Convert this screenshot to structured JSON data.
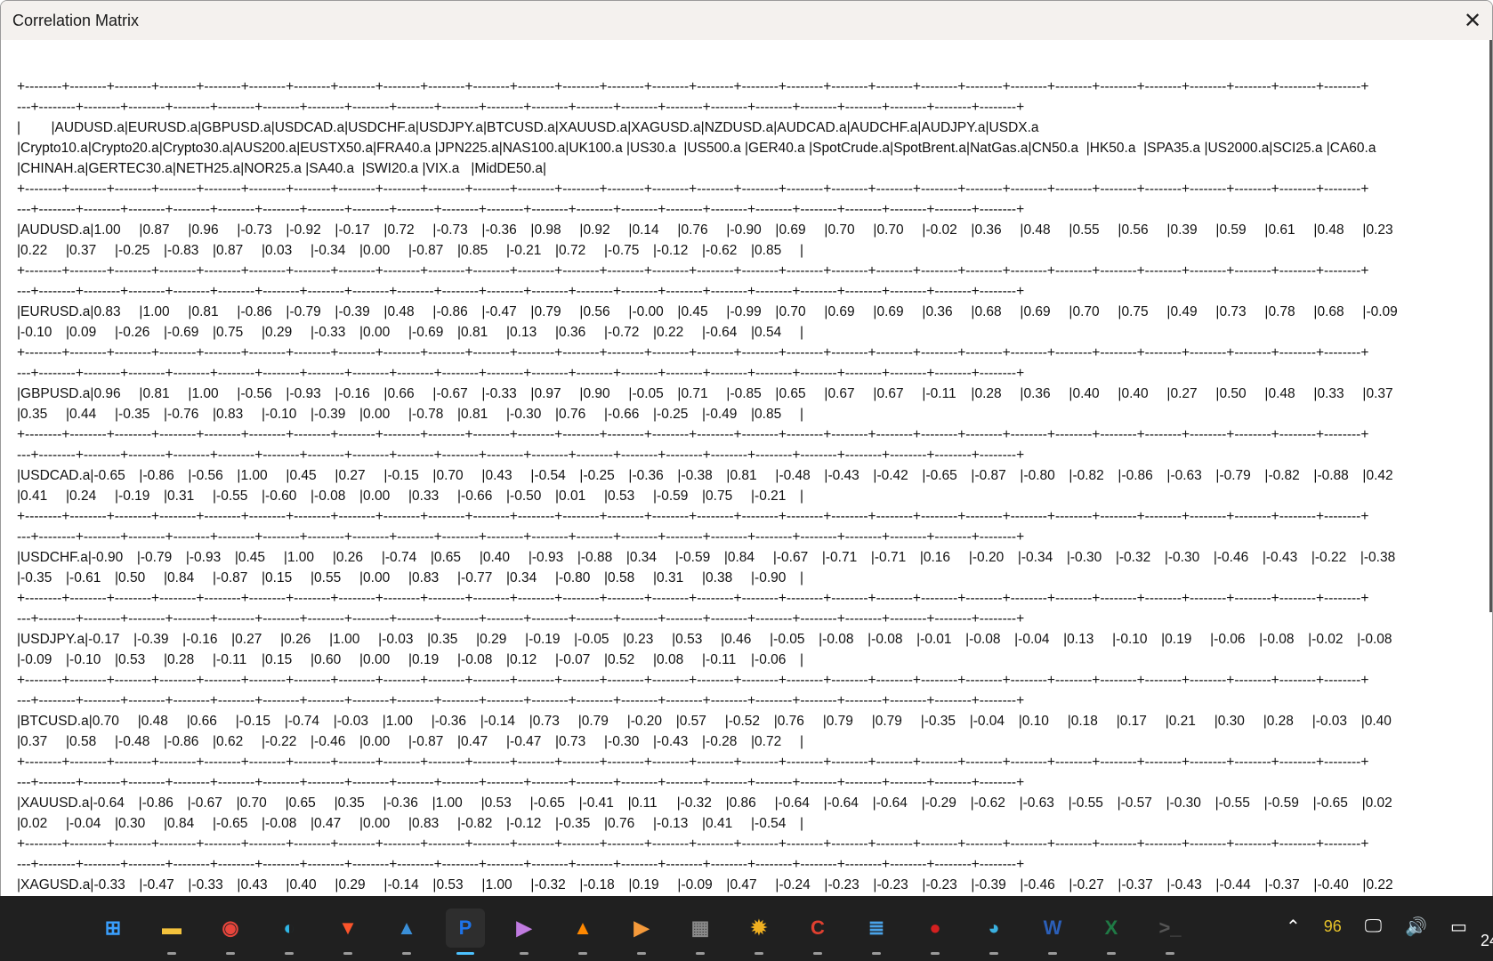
{
  "window": {
    "title": "Correlation Matrix",
    "close_icon": "close-icon"
  },
  "separator": [
    "+--------+--------+--------+--------+--------+--------+--------+--------+--------+--------+--------+--------+--------+--------+--------+--------+--------+--------+--------+--------+--------+--------+--------+--------+--------+--------+--------+--------+--------+--------+",
    "---+--------+--------+--------+--------+--------+--------+--------+--------+--------+--------+--------+--------+--------+--------+--------+--------+--------+--------+--------+--------+--------+--------+"
  ],
  "header_lines": [
    "|        |AUDUSD.a|EURUSD.a|GBPUSD.a|USDCAD.a|USDCHF.a|USDJPY.a|BTCUSD.a|XAUUSD.a|XAGUSD.a|NZDUSD.a|AUDCAD.a|AUDCHF.a|AUDJPY.a|USDX.a",
    "|Crypto10.a|Crypto20.a|Crypto30.a|AUS200.a|EUSTX50.a|FRA40.a |JPN225.a|NAS100.a|UK100.a |US30.a  |US500.a |GER40.a |SpotCrude.a|SpotBrent.a|NatGas.a|CN50.a  |HK50.a  |SPA35.a |US2000.a|SCI25.a |CA60.a",
    "|CHINAH.a|GERTEC30.a|NETH25.a|NOR25.a |SA40.a  |SWI20.a |VIX.a   |MidDE50.a|"
  ],
  "rows": [
    {
      "label": "AUDUSD.a",
      "values": [
        "1.00",
        "0.87",
        "0.96",
        "-0.73",
        "-0.92",
        "-0.17",
        "0.72",
        "-0.73",
        "-0.36",
        "0.98",
        "0.92",
        "0.14",
        "0.76",
        "-0.90",
        "0.69",
        "0.70",
        "0.70",
        "-0.02",
        "0.36",
        "0.48",
        "0.55",
        "0.56",
        "0.39",
        "0.59",
        "0.61",
        "0.48",
        "0.23",
        "0.22",
        "0.37",
        "-0.25",
        "-0.83",
        "0.87",
        "0.03",
        "-0.34",
        "0.00",
        "-0.87",
        "0.85",
        "-0.21",
        "0.72",
        "-0.75",
        "-0.12",
        "-0.62",
        "0.85"
      ]
    },
    {
      "label": "EURUSD.a",
      "values": [
        "0.83",
        "1.00",
        "0.81",
        "-0.86",
        "-0.79",
        "-0.39",
        "0.48",
        "-0.86",
        "-0.47",
        "0.79",
        "0.56",
        "-0.00",
        "0.45",
        "-0.99",
        "0.70",
        "0.69",
        "0.69",
        "0.36",
        "0.68",
        "0.69",
        "0.70",
        "0.75",
        "0.49",
        "0.73",
        "0.78",
        "0.68",
        "-0.09",
        "-0.10",
        "0.09",
        "-0.26",
        "-0.69",
        "0.75",
        "0.29",
        "-0.33",
        "0.00",
        "-0.69",
        "0.81",
        "0.13",
        "0.36",
        "-0.72",
        "0.22",
        "-0.64",
        "0.54"
      ]
    },
    {
      "label": "GBPUSD.a",
      "values": [
        "0.96",
        "0.81",
        "1.00",
        "-0.56",
        "-0.93",
        "-0.16",
        "0.66",
        "-0.67",
        "-0.33",
        "0.97",
        "0.90",
        "-0.05",
        "0.71",
        "-0.85",
        "0.65",
        "0.67",
        "0.67",
        "-0.11",
        "0.28",
        "0.36",
        "0.40",
        "0.40",
        "0.27",
        "0.50",
        "0.48",
        "0.33",
        "0.37",
        "0.35",
        "0.44",
        "-0.35",
        "-0.76",
        "0.83",
        "-0.10",
        "-0.39",
        "0.00",
        "-0.78",
        "0.81",
        "-0.30",
        "0.76",
        "-0.66",
        "-0.25",
        "-0.49",
        "0.85"
      ]
    },
    {
      "label": "USDCAD.a",
      "values": [
        "-0.65",
        "-0.86",
        "-0.56",
        "1.00",
        "0.45",
        "0.27",
        "-0.15",
        "0.70",
        "0.43",
        "-0.54",
        "-0.25",
        "-0.36",
        "-0.38",
        "0.81",
        "-0.48",
        "-0.43",
        "-0.42",
        "-0.65",
        "-0.87",
        "-0.80",
        "-0.82",
        "-0.86",
        "-0.63",
        "-0.79",
        "-0.82",
        "-0.88",
        "0.42",
        "0.41",
        "0.24",
        "-0.19",
        "0.31",
        "-0.55",
        "-0.60",
        "-0.08",
        "0.00",
        "0.33",
        "-0.66",
        "-0.50",
        "0.01",
        "0.53",
        "-0.59",
        "0.75",
        "-0.21"
      ]
    },
    {
      "label": "USDCHF.a",
      "values": [
        "-0.90",
        "-0.79",
        "-0.93",
        "0.45",
        "1.00",
        "0.26",
        "-0.74",
        "0.65",
        "0.40",
        "-0.93",
        "-0.88",
        "0.34",
        "-0.59",
        "0.84",
        "-0.67",
        "-0.71",
        "-0.71",
        "0.16",
        "-0.20",
        "-0.34",
        "-0.30",
        "-0.32",
        "-0.30",
        "-0.46",
        "-0.43",
        "-0.22",
        "-0.38",
        "-0.35",
        "-0.61",
        "0.50",
        "0.84",
        "-0.87",
        "0.15",
        "0.55",
        "0.00",
        "0.83",
        "-0.77",
        "0.34",
        "-0.80",
        "0.58",
        "0.31",
        "0.38",
        "-0.90"
      ]
    },
    {
      "label": "USDJPY.a",
      "values": [
        "-0.17",
        "-0.39",
        "-0.16",
        "0.27",
        "0.26",
        "1.00",
        "-0.03",
        "0.35",
        "0.29",
        "-0.19",
        "-0.05",
        "0.23",
        "0.53",
        "0.46",
        "-0.05",
        "-0.08",
        "-0.08",
        "-0.01",
        "-0.08",
        "-0.04",
        "0.13",
        "-0.10",
        "0.19",
        "-0.06",
        "-0.08",
        "-0.02",
        "-0.08",
        "-0.09",
        "-0.10",
        "0.53",
        "0.28",
        "-0.11",
        "0.15",
        "0.60",
        "0.00",
        "0.19",
        "-0.08",
        "0.12",
        "-0.07",
        "0.52",
        "0.08",
        "-0.11",
        "-0.06"
      ]
    },
    {
      "label": "BTCUSD.a",
      "values": [
        "0.70",
        "0.48",
        "0.66",
        "-0.15",
        "-0.74",
        "-0.03",
        "1.00",
        "-0.36",
        "-0.14",
        "0.73",
        "0.79",
        "-0.20",
        "0.57",
        "-0.52",
        "0.76",
        "0.79",
        "0.79",
        "-0.35",
        "-0.04",
        "0.10",
        "0.18",
        "0.17",
        "0.21",
        "0.30",
        "0.28",
        "-0.03",
        "0.40",
        "0.37",
        "0.58",
        "-0.48",
        "-0.86",
        "0.62",
        "-0.22",
        "-0.46",
        "0.00",
        "-0.87",
        "0.47",
        "-0.47",
        "0.73",
        "-0.30",
        "-0.43",
        "-0.28",
        "0.72"
      ]
    },
    {
      "label": "XAUUSD.a",
      "values": [
        "-0.64",
        "-0.86",
        "-0.67",
        "0.70",
        "0.65",
        "0.35",
        "-0.36",
        "1.00",
        "0.53",
        "-0.65",
        "-0.41",
        "0.11",
        "-0.32",
        "0.86",
        "-0.64",
        "-0.64",
        "-0.64",
        "-0.29",
        "-0.62",
        "-0.63",
        "-0.55",
        "-0.57",
        "-0.30",
        "-0.55",
        "-0.59",
        "-0.65",
        "0.02",
        "0.02",
        "-0.04",
        "0.30",
        "0.84",
        "-0.65",
        "-0.08",
        "0.47",
        "0.00",
        "0.83",
        "-0.82",
        "-0.12",
        "-0.35",
        "0.76",
        "-0.13",
        "0.41",
        "-0.54"
      ]
    },
    {
      "label": "XAGUSD.a",
      "values": [
        "-0.33",
        "-0.47",
        "-0.33",
        "0.43",
        "0.40",
        "0.29",
        "-0.14",
        "0.53",
        "1.00",
        "-0.32",
        "-0.18",
        "0.19",
        "-0.09",
        "0.47",
        "-0.24",
        "-0.23",
        "-0.23",
        "-0.23",
        "-0.39",
        "-0.46",
        "-0.27",
        "-0.37",
        "-0.43",
        "-0.44",
        "-0.37",
        "-0.40",
        "0.22"
      ]
    }
  ],
  "taskbar": {
    "apps": [
      {
        "name": "start-icon",
        "glyph": "⊞",
        "color": "#3aa0ff"
      },
      {
        "name": "file-explorer-icon",
        "glyph": "▬",
        "color": "#f3c23c"
      },
      {
        "name": "chrome-icon",
        "glyph": "◉",
        "color": "#e8453c"
      },
      {
        "name": "edge-icon",
        "glyph": "◐",
        "color": "#2fb6e6"
      },
      {
        "name": "brave-icon",
        "glyph": "▼",
        "color": "#fb542b"
      },
      {
        "name": "photos-icon",
        "glyph": "▲",
        "color": "#3a8fd8"
      },
      {
        "name": "p-app-icon",
        "glyph": "P",
        "color": "#1e73e8",
        "active": true
      },
      {
        "name": "media-player-icon",
        "glyph": "▶",
        "color": "#c07be0"
      },
      {
        "name": "vlc-icon",
        "glyph": "▲",
        "color": "#ff8800"
      },
      {
        "name": "video-player-icon",
        "glyph": "▶",
        "color": "#f59a3b"
      },
      {
        "name": "calculator-icon",
        "glyph": "▦",
        "color": "#8a8a8a"
      },
      {
        "name": "settings-gear-icon",
        "glyph": "✹",
        "color": "#f0b020"
      },
      {
        "name": "ccleaner-icon",
        "glyph": "C",
        "color": "#e04030"
      },
      {
        "name": "notepad-icon",
        "glyph": "≣",
        "color": "#4aa3e8"
      },
      {
        "name": "red-app-icon",
        "glyph": "●",
        "color": "#d42020"
      },
      {
        "name": "paint-icon",
        "glyph": "◕",
        "color": "#3ab0e0"
      },
      {
        "name": "word-icon",
        "glyph": "W",
        "color": "#2b5fb8"
      },
      {
        "name": "excel-icon",
        "glyph": "X",
        "color": "#1f7a45"
      },
      {
        "name": "terminal-icon",
        "glyph": ">_",
        "color": "#555555"
      }
    ],
    "tray": {
      "chevron_icon": "chevron-up-icon",
      "temperature": "96",
      "network_icon": "network-icon",
      "volume_icon": "volume-icon",
      "battery_icon": "battery-icon",
      "clock_partial": "24"
    }
  }
}
